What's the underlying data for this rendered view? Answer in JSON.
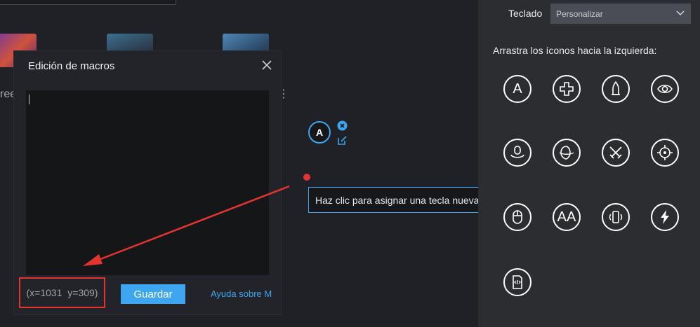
{
  "background": {
    "partial_text": "ree",
    "menu_glyph": "⋮"
  },
  "macro_dialog": {
    "title": "Edición de macros",
    "coordinates": "(x=1031  y=309)",
    "save_label": "Guardar",
    "help_label": "Ayuda sobre M"
  },
  "floating_key": {
    "label": "A"
  },
  "tooltip": {
    "text": "Haz clic para asignar una tecla nueva."
  },
  "panel": {
    "keyboard_label": "Teclado",
    "keyboard_selected": "Personalizar",
    "drag_hint": "Arrastra los íconos hacia la izquierda:",
    "icons": [
      {
        "name": "tap-key-icon",
        "text": "A"
      },
      {
        "name": "dpad-icon"
      },
      {
        "name": "fire-icon"
      },
      {
        "name": "eye-icon"
      },
      {
        "name": "rotate-view-icon"
      },
      {
        "name": "gyro-rotate-icon"
      },
      {
        "name": "crossed-swords-icon"
      },
      {
        "name": "crosshair-icon"
      },
      {
        "name": "mouse-icon"
      },
      {
        "name": "multi-tap-icon",
        "text": "AA"
      },
      {
        "name": "phone-shake-icon"
      },
      {
        "name": "lightning-icon"
      },
      {
        "name": "script-icon"
      }
    ]
  },
  "colors": {
    "accent": "#3ea6f1",
    "highlight": "#e3342f",
    "background": "#1f2126",
    "panel": "#2b2d31"
  }
}
